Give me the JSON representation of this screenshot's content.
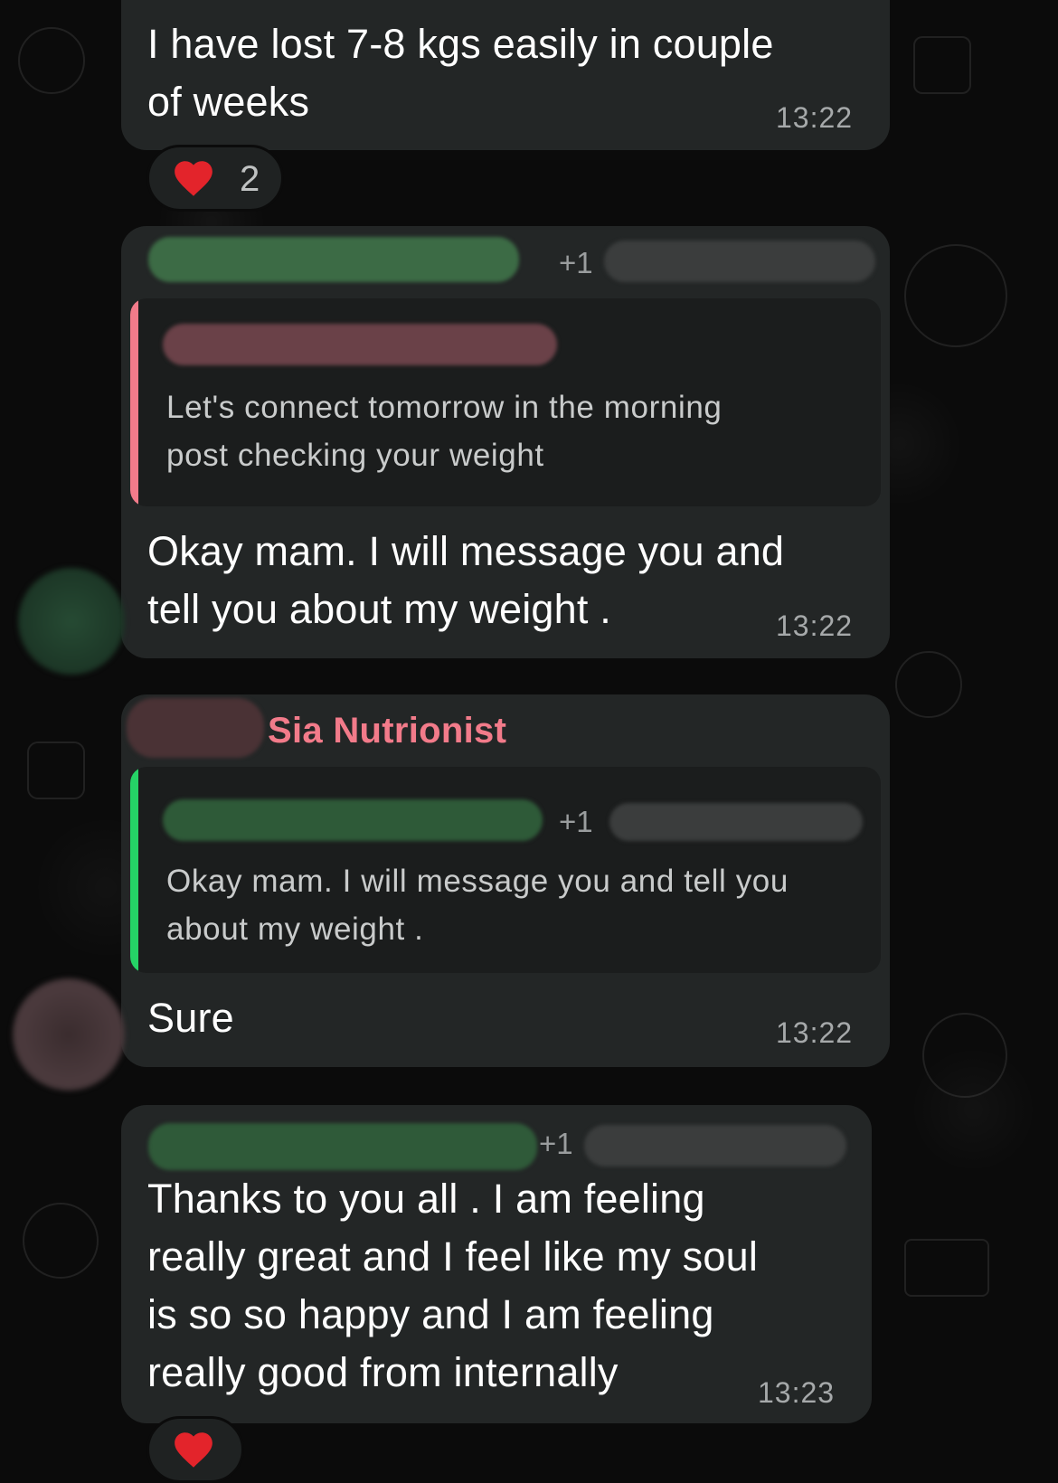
{
  "messages": [
    {
      "text_line1": "I have lost 7-8 kgs easily in couple",
      "text_line2": "of weeks",
      "time": "13:22",
      "reaction": {
        "emoji": "heart-icon",
        "count": "2"
      }
    },
    {
      "sender_extra": "+1",
      "quote": {
        "text_line1": "Let's connect tomorrow in the morning",
        "text_line2": "post checking your weight",
        "bar_color": "#f27b8a"
      },
      "text_line1": "Okay mam. I will message you and",
      "text_line2": "tell you about my weight .",
      "time": "13:22"
    },
    {
      "sender": "Sia Nutrionist",
      "sender_color": "#f27b8a",
      "quote": {
        "sender_extra": "+1",
        "text_line1": "Okay mam. I will message you and tell you",
        "text_line2": "about my weight .",
        "bar_color": "#25d366"
      },
      "text_line1": "Sure",
      "time": "13:22"
    },
    {
      "sender_extra": "+1",
      "text_line1": "Thanks to you all . I am feeling",
      "text_line2": "really great and I feel like my soul",
      "text_line3": "is so so happy and I am feeling",
      "text_line4": "really good from internally",
      "time": "13:23",
      "reaction": {
        "emoji": "heart-icon"
      }
    }
  ],
  "colors": {
    "background": "#0b0b0b",
    "bubble": "#232626",
    "quote_bg": "#1b1d1d",
    "accent_green": "#25d366",
    "accent_pink": "#f27b8a"
  }
}
